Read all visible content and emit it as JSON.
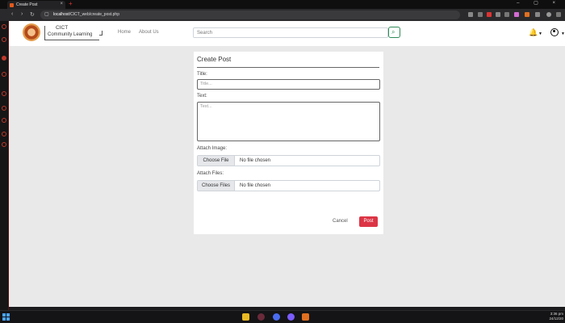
{
  "browser": {
    "tab_title": "Create Post",
    "tab_close": "×",
    "new_tab": "+",
    "url_host": "localhost",
    "url_path": "/CICT_web/create_post.php",
    "window_controls": "– ▢ ×"
  },
  "header": {
    "brand_line1": "CICT",
    "brand_line2": "Community Learning",
    "nav": [
      "Home",
      "About Us"
    ],
    "search_placeholder": "Search",
    "search_icon": "magnifier-icon",
    "notification_icon": "bell-icon",
    "profile_icon": "user-circle-icon"
  },
  "form": {
    "heading": "Create Post",
    "title_label": "Title:",
    "title_placeholder": "Title...",
    "text_label": "Text:",
    "text_placeholder": "Text...",
    "image_label": "Attach Image:",
    "image_button": "Choose File",
    "image_status": "No file chosen",
    "files_label": "Attach Files:",
    "files_button": "Choose Files",
    "files_status": "No file chosen",
    "cancel_label": "Cancel",
    "post_label": "Post"
  },
  "taskbar": {
    "time": "3:36 pm",
    "date": "24/12/20"
  },
  "colors": {
    "accent": "#dc3545",
    "search_button": "#2e8b57",
    "page_bg": "#e9e9e9"
  }
}
